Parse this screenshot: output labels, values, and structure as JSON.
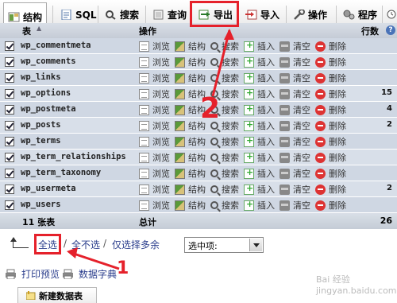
{
  "tabs": [
    {
      "label": "结构",
      "icon": "structure-icon",
      "active": true
    },
    {
      "label": "SQL",
      "icon": "sql-icon"
    },
    {
      "label": "搜索",
      "icon": "search-icon"
    },
    {
      "label": "查询",
      "icon": "query-icon"
    },
    {
      "label": "导出",
      "icon": "export-icon"
    },
    {
      "label": "导入",
      "icon": "import-icon"
    },
    {
      "label": "操作",
      "icon": "operations-icon"
    },
    {
      "label": "程序",
      "icon": "routines-icon"
    }
  ],
  "table": {
    "col_table": "表",
    "col_action": "操作",
    "col_rows": "行数",
    "actions": [
      "浏览",
      "结构",
      "搜索",
      "插入",
      "清空",
      "删除"
    ],
    "rows": [
      {
        "name": "wp_commentmeta",
        "rows": ""
      },
      {
        "name": "wp_comments",
        "rows": ""
      },
      {
        "name": "wp_links",
        "rows": ""
      },
      {
        "name": "wp_options",
        "rows": "15"
      },
      {
        "name": "wp_postmeta",
        "rows": "4"
      },
      {
        "name": "wp_posts",
        "rows": "2"
      },
      {
        "name": "wp_terms",
        "rows": ""
      },
      {
        "name": "wp_term_relationships",
        "rows": ""
      },
      {
        "name": "wp_term_taxonomy",
        "rows": ""
      },
      {
        "name": "wp_usermeta",
        "rows": "2"
      },
      {
        "name": "wp_users",
        "rows": ""
      }
    ],
    "summary_count": "11 张表",
    "summary_label": "总计",
    "summary_rows": "26"
  },
  "bulk": {
    "select_all": "全选",
    "sep1": "/",
    "deselect_all": "全不选",
    "sep2": "/",
    "select_overhead": "仅选择多余",
    "with_selected": "选中项:"
  },
  "footer": {
    "print_view": "打印预览",
    "data_dictionary": "数据字典",
    "create_table": "新建数据表"
  },
  "annotations": {
    "step1": "1",
    "step2": "2",
    "color": "#e5212b"
  },
  "watermark": "Bai 经验 jingyan.baidu.com"
}
